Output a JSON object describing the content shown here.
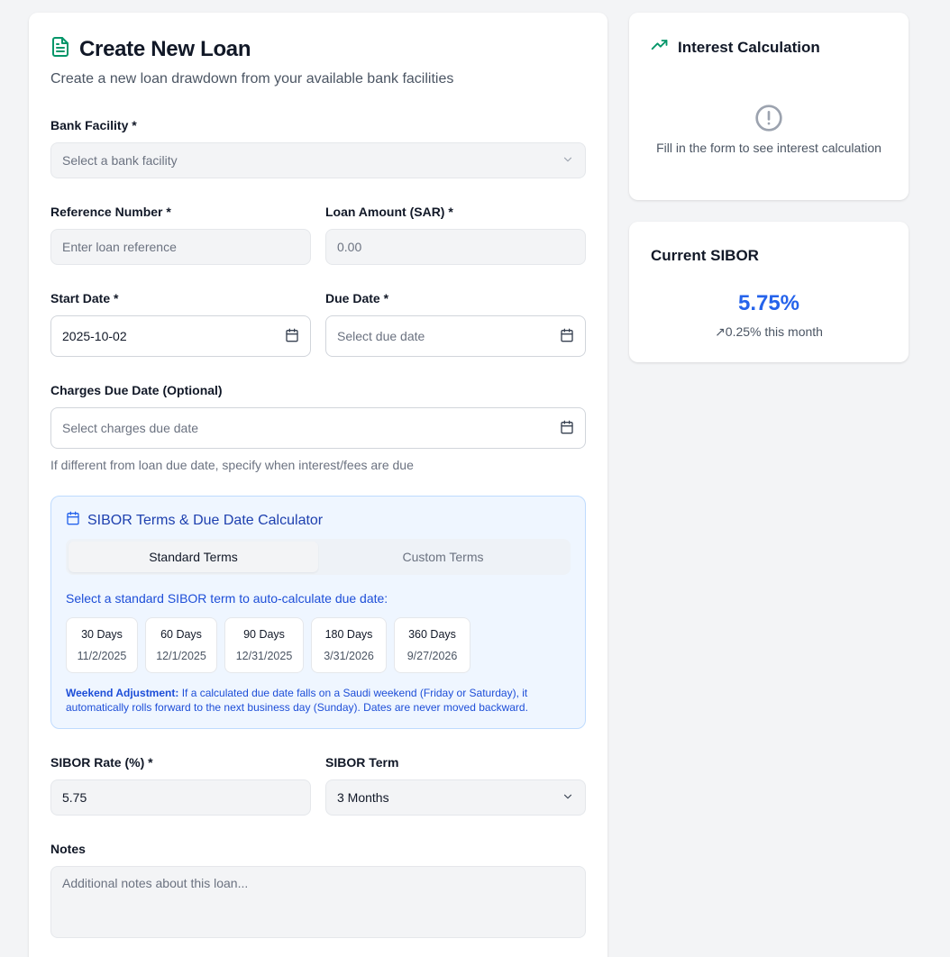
{
  "form": {
    "title": "Create New Loan",
    "subtitle": "Create a new loan drawdown from your available bank facilities",
    "bank_facility": {
      "label": "Bank Facility *",
      "placeholder": "Select a bank facility"
    },
    "reference_number": {
      "label": "Reference Number *",
      "placeholder": "Enter loan reference"
    },
    "loan_amount": {
      "label": "Loan Amount (SAR) *",
      "placeholder": "0.00"
    },
    "start_date": {
      "label": "Start Date *",
      "value": "2025-10-02"
    },
    "due_date": {
      "label": "Due Date *",
      "placeholder": "Select due date"
    },
    "charges_due_date": {
      "label": "Charges Due Date (Optional)",
      "placeholder": "Select charges due date",
      "hint": "If different from loan due date, specify when interest/fees are due"
    },
    "calculator": {
      "title": "SIBOR Terms & Due Date Calculator",
      "tabs": [
        {
          "label": "Standard Terms"
        },
        {
          "label": "Custom Terms"
        }
      ],
      "active_tab": "Standard Terms",
      "instruction": "Select a standard SIBOR term to auto-calculate due date:",
      "terms": [
        {
          "days": "30 Days",
          "date": "11/2/2025"
        },
        {
          "days": "60 Days",
          "date": "12/1/2025"
        },
        {
          "days": "90 Days",
          "date": "12/31/2025"
        },
        {
          "days": "180 Days",
          "date": "3/31/2026"
        },
        {
          "days": "360 Days",
          "date": "9/27/2026"
        }
      ],
      "weekend_title": "Weekend Adjustment:",
      "weekend_text": " If a calculated due date falls on a Saudi weekend (Friday or Saturday), it automatically rolls forward to the next business day (Sunday). Dates are never moved backward."
    },
    "sibor_rate": {
      "label": "SIBOR Rate (%) *",
      "value": "5.75"
    },
    "sibor_term": {
      "label": "SIBOR Term",
      "value": "3 Months"
    },
    "notes": {
      "label": "Notes",
      "placeholder": "Additional notes about this loan..."
    }
  },
  "interest_panel": {
    "title": "Interest Calculation",
    "empty_text": "Fill in the form to see interest calculation"
  },
  "sibor_panel": {
    "title": "Current SIBOR",
    "rate": "5.75%",
    "change": "0.25% this month"
  },
  "colors": {
    "accent": "#2563eb",
    "success": "#059669",
    "calc_bg": "#eff6ff",
    "calc_text": "#1d4ed8"
  }
}
